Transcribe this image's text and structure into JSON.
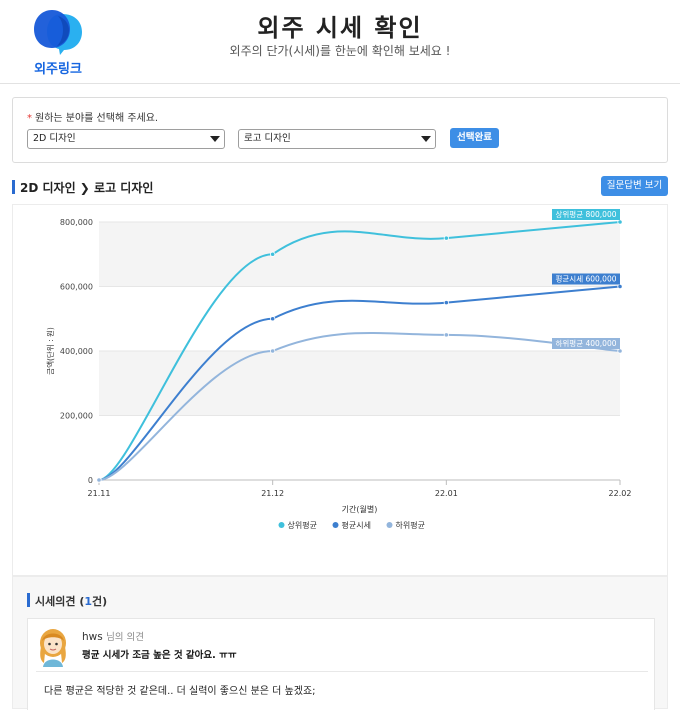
{
  "header": {
    "logo_text": "외주링크",
    "title": "외주 시세 확인",
    "subtitle": "외주의 단가(시세)를 한눈에 확인해 보세요 !"
  },
  "selector": {
    "required_mark": "*",
    "prompt": "원하는 분야를 선택해 주세요.",
    "category_selected": "2D 디자인",
    "subcategory_selected": "로고 디자인",
    "confirm_label": "선택완료"
  },
  "section": {
    "category": "2D 디자인",
    "separator": "❯",
    "subcategory": "로고 디자인",
    "qa_button": "질문답변 보기"
  },
  "chart_data": {
    "type": "line",
    "title": "",
    "xlabel": "기간(월별)",
    "ylabel": "금액(단위 : 원)",
    "ylim": [
      0,
      800000
    ],
    "yticks": [
      "0",
      "200,000",
      "400,000",
      "600,000",
      "800,000"
    ],
    "x": [
      "21.11",
      "21.12",
      "22.01",
      "22.02"
    ],
    "grid": true,
    "legend_position": "bottom",
    "series": [
      {
        "name": "상위평균",
        "color": "#3fc0dc",
        "values": [
          0,
          700000,
          750000,
          800000
        ],
        "end_label": "상위평균 800,000"
      },
      {
        "name": "평균시세",
        "color": "#3d7fcf",
        "values": [
          0,
          500000,
          550000,
          600000
        ],
        "end_label": "평균시세 600,000"
      },
      {
        "name": "하위평균",
        "color": "#93b5dc",
        "values": [
          0,
          400000,
          450000,
          400000
        ],
        "end_label": "하위평균 400,000"
      }
    ]
  },
  "opinions": {
    "title": "시세의견",
    "count": "1",
    "count_suffix": "건",
    "items": [
      {
        "author": "hws",
        "author_suffix": "님의 의견",
        "summary": "평균 시세가 조금 높은 것 같아요. ㅠㅠ",
        "body": "다른 평균은 적당한 것 같은데.. 더 실력이 좋으신 분은 더 높겠죠;"
      }
    ]
  },
  "colors": {
    "accent": "#3d8ee6",
    "brand": "#1565e0"
  }
}
